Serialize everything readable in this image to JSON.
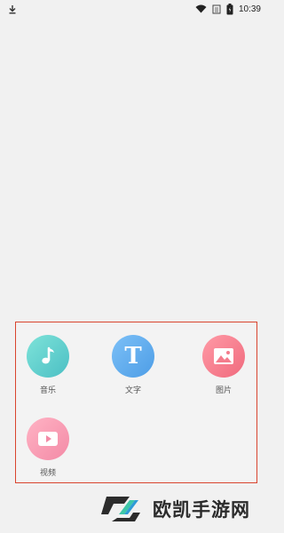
{
  "status_bar": {
    "time": "10:39",
    "icons": [
      "download-icon",
      "wifi-icon",
      "sim-icon",
      "battery-icon"
    ]
  },
  "panel": {
    "border_color": "#d9442e",
    "items": [
      {
        "label": "音乐",
        "icon": "music-note-icon",
        "color": "#5fd0cf"
      },
      {
        "label": "文字",
        "icon": "letter-t-icon",
        "glyph": "T",
        "color": "#5fadef"
      },
      {
        "label": "图片",
        "icon": "picture-icon",
        "color": "#f47c8c"
      },
      {
        "label": "视频",
        "icon": "play-icon",
        "color": "#f79bb4"
      }
    ]
  },
  "watermark": {
    "text": "欧凯手游网",
    "logo": "ouk-logo"
  }
}
